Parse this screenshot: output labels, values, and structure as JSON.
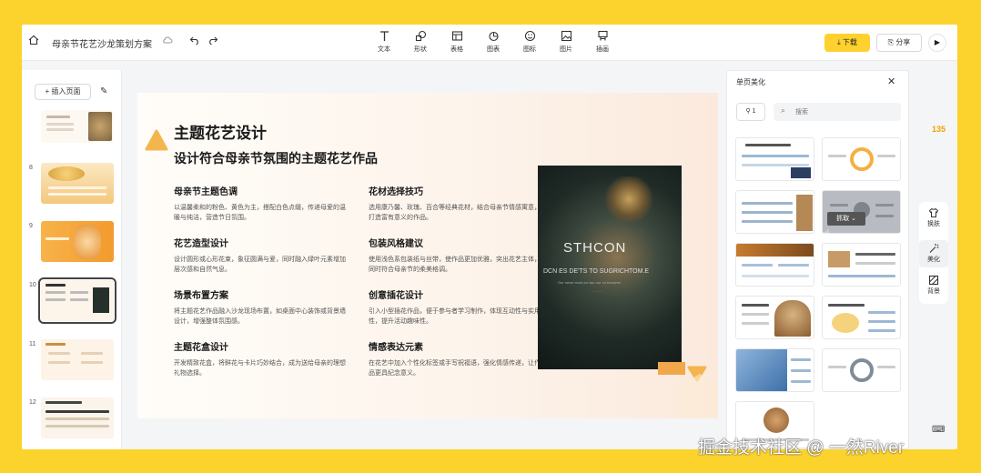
{
  "toolbar": {
    "doc_title": "母亲节花艺沙龙策划方案",
    "tools": [
      "文本",
      "形状",
      "表格",
      "图表",
      "图标",
      "图片",
      "插画"
    ],
    "download_label": "下载",
    "share_label": "分享"
  },
  "left_panel": {
    "insert_label": "+ 插入页面",
    "page_numbers": [
      "8",
      "9",
      "10",
      "11",
      "12"
    ],
    "active_page": "10"
  },
  "slide": {
    "title": "主题花艺设计",
    "subtitle": "设计符合母亲节氛围的主题花艺作品",
    "items": [
      {
        "heading": "母亲节主题色调",
        "text": "以温馨柔和的粉色、黄色为主，搭配白色点缀，传递母爱的温暖与纯洁，营造节日氛围。"
      },
      {
        "heading": "花材选择技巧",
        "text": "选用康乃馨、玫瑰、百合等经典花材，结合母亲节情感寓意，打造富有意义的作品。"
      },
      {
        "heading": "花艺造型设计",
        "text": "设计圆形或心形花束，象征圆满与爱，同时融入绿叶元素增加层次感和自然气息。"
      },
      {
        "heading": "包装风格建议",
        "text": "使用浅色系包装纸与丝带，使作品更加优雅，突出花艺主体，同时符合母亲节的柔美格调。"
      },
      {
        "heading": "场景布置方案",
        "text": "将主题花艺作品融入沙龙现场布置，如桌面中心装饰或背景墙设计，增强整体氛围感。"
      },
      {
        "heading": "创意插花设计",
        "text": "引入小型插花作品，便于参与者学习制作，体现互动性与实用性，提升活动趣味性。"
      },
      {
        "heading": "主题花盒设计",
        "text": "开发精致花盒，将鲜花与卡片巧妙结合，成为送给母亲的理想礼物选择。"
      },
      {
        "heading": "情感表达元素",
        "text": "在花艺中加入个性化标签或手写祝福语，强化情感传递，让作品更具纪念意义。"
      }
    ],
    "photo": {
      "line1": "STHCON",
      "line2": "DCN ES DE'TS TO SUGRICHTOM.E",
      "line3": "Our never read our tau our on beaness",
      "line4": "···· ···"
    }
  },
  "right_panel": {
    "title": "单页美化",
    "filter_count": "1",
    "search_placeholder": "搜索",
    "grab_tip": "抓取",
    "side_number": "135"
  },
  "side_tools": [
    "换肤",
    "美化",
    "背景"
  ],
  "watermark": "掘金技术社区 @ 一然River",
  "colors": {
    "accent": "#ffd12e",
    "frame": "#fcd22c",
    "orange": "#f0a84a"
  }
}
